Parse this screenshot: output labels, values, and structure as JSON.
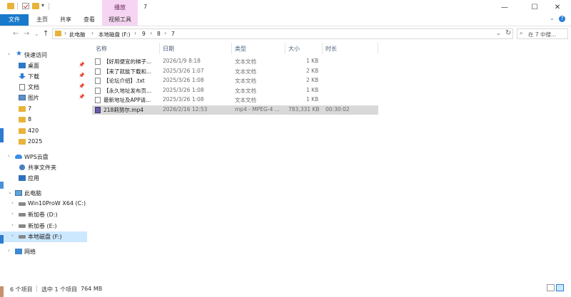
{
  "window": {
    "title": "7",
    "contextual_group": "播放",
    "minimize": "—",
    "maximize": "☐",
    "close": "✕"
  },
  "ribbon": {
    "tabs": [
      "文件",
      "主页",
      "共享",
      "查看",
      "视频工具"
    ],
    "help": "?"
  },
  "address": {
    "back": "←",
    "forward": "→",
    "dropdown": "⌄",
    "up": "↑",
    "crumbs": [
      "此电脑",
      "本地磁盘 (F:)",
      "9",
      "8",
      "7"
    ],
    "refresh": "↻",
    "search_placeholder": "在 7 中搜..."
  },
  "sidebar": {
    "quick_access": "快速访问",
    "pinned": [
      {
        "label": "桌面",
        "icon": "desktop-icon"
      },
      {
        "label": "下载",
        "icon": "download-icon"
      },
      {
        "label": "文档",
        "icon": "document-icon"
      },
      {
        "label": "图片",
        "icon": "picture-icon"
      }
    ],
    "folders": [
      "7",
      "8",
      "420",
      "2025"
    ],
    "wps": "WPS云盘",
    "wps_items": [
      "共享文件夹",
      "应用"
    ],
    "this_pc": "此电脑",
    "drives": [
      "Win10ProW X64 (C:)",
      "新加卷 (D:)",
      "新加卷 (E:)",
      "本地磁盘 (F:)"
    ],
    "network": "网络"
  },
  "columns": [
    "名称",
    "日期",
    "类型",
    "大小",
    "时长"
  ],
  "files": [
    {
      "name": "【好用便宜的梯子...",
      "date": "2026/1/9 8:18",
      "type": "文本文档",
      "size": "1 KB",
      "length": ""
    },
    {
      "name": "【来了就能下载和...",
      "date": "2025/3/26 1:07",
      "type": "文本文档",
      "size": "2 KB",
      "length": ""
    },
    {
      "name": "【论坛介绍】.txt",
      "date": "2025/3/26 1:08",
      "type": "文本文档",
      "size": "2 KB",
      "length": ""
    },
    {
      "name": "【永久地址发布页...",
      "date": "2025/3/26 1:08",
      "type": "文本文档",
      "size": "1 KB",
      "length": ""
    },
    {
      "name": "最新地址及APP请...",
      "date": "2025/3/26 1:08",
      "type": "文本文档",
      "size": "1 KB",
      "length": ""
    },
    {
      "name": "218莉努尔.mp4",
      "date": "2026/2/16 12:53",
      "type": "mp4 - MPEG-4 ...",
      "size": "783,331 KB",
      "length": "00:30:02"
    }
  ],
  "status": {
    "count": "6 个项目",
    "selected": "选中 1 个项目",
    "size": "764 MB"
  }
}
